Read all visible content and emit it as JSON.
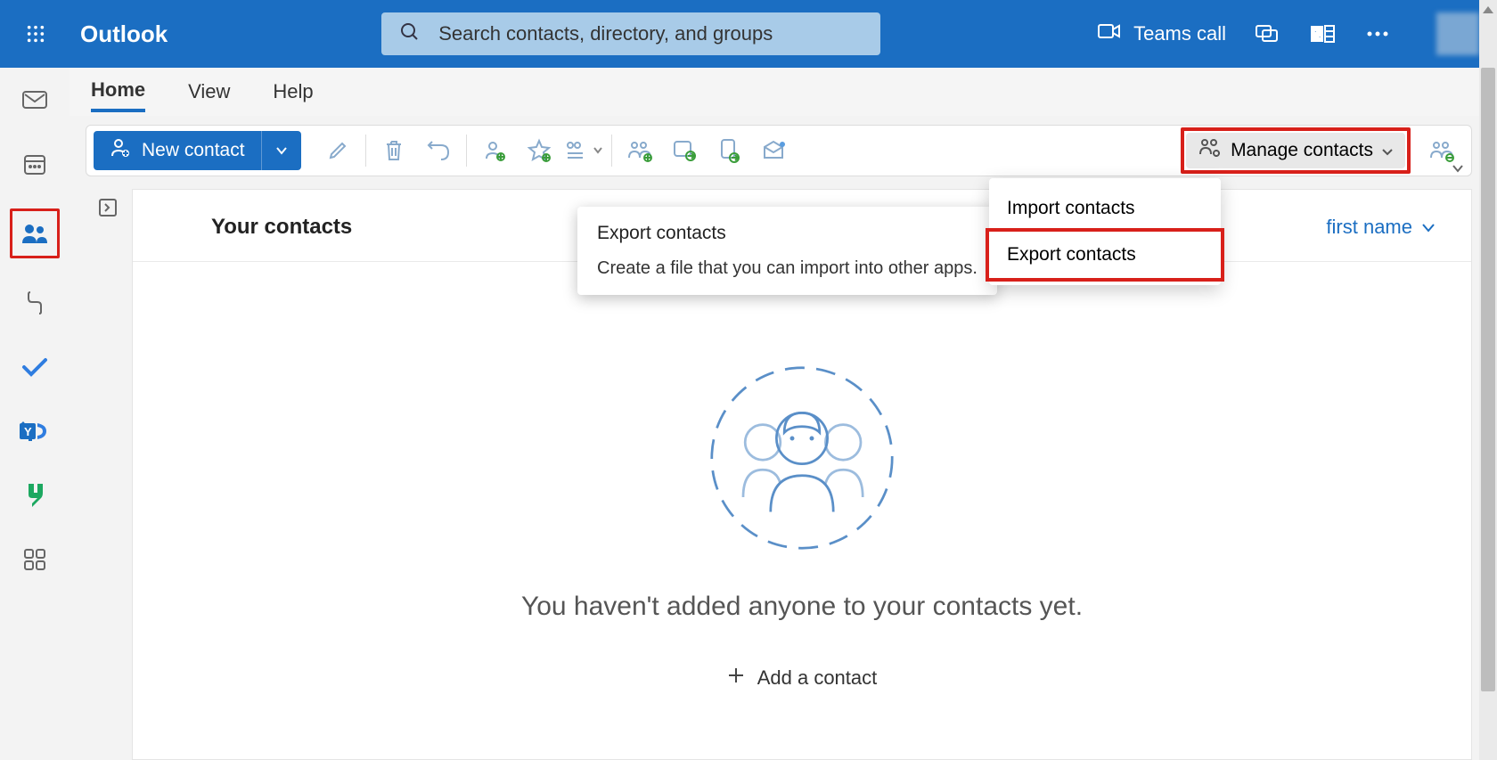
{
  "header": {
    "brand": "Outlook",
    "search_placeholder": "Search contacts, directory, and groups",
    "teams_call": "Teams call"
  },
  "tabs": {
    "home": "Home",
    "view": "View",
    "help": "Help"
  },
  "toolbar": {
    "new_contact": "New contact",
    "manage_contacts": "Manage contacts"
  },
  "dropdown": {
    "import": "Import contacts",
    "export": "Export contacts"
  },
  "tooltip": {
    "title": "Export contacts",
    "desc": "Create a file that you can import into other apps."
  },
  "main": {
    "title": "Your contacts",
    "sort_label": "first name",
    "empty_text": "You haven't added anyone to your contacts yet.",
    "add_contact": "Add a contact"
  }
}
